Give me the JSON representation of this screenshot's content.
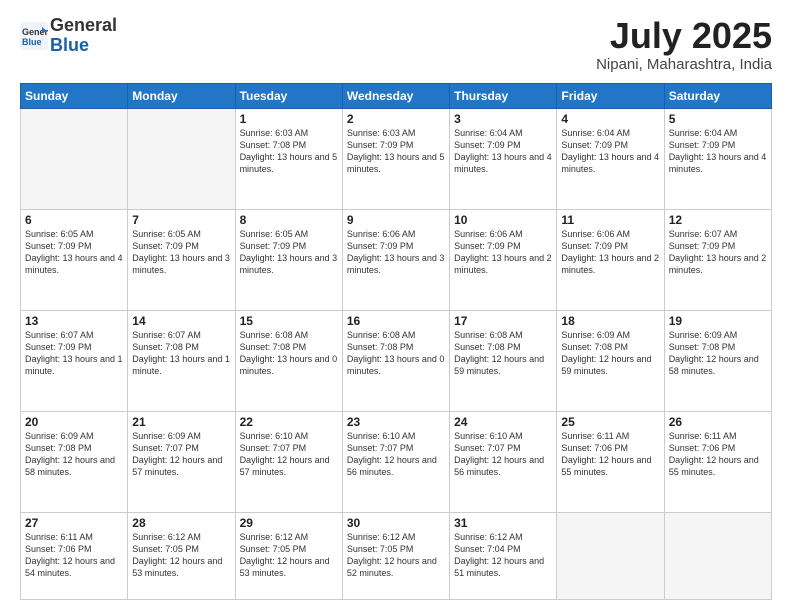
{
  "header": {
    "logo_general": "General",
    "logo_blue": "Blue",
    "month_title": "July 2025",
    "location": "Nipani, Maharashtra, India"
  },
  "days_of_week": [
    "Sunday",
    "Monday",
    "Tuesday",
    "Wednesday",
    "Thursday",
    "Friday",
    "Saturday"
  ],
  "weeks": [
    [
      {
        "day": "",
        "info": ""
      },
      {
        "day": "",
        "info": ""
      },
      {
        "day": "1",
        "info": "Sunrise: 6:03 AM\nSunset: 7:08 PM\nDaylight: 13 hours and 5 minutes."
      },
      {
        "day": "2",
        "info": "Sunrise: 6:03 AM\nSunset: 7:09 PM\nDaylight: 13 hours and 5 minutes."
      },
      {
        "day": "3",
        "info": "Sunrise: 6:04 AM\nSunset: 7:09 PM\nDaylight: 13 hours and 4 minutes."
      },
      {
        "day": "4",
        "info": "Sunrise: 6:04 AM\nSunset: 7:09 PM\nDaylight: 13 hours and 4 minutes."
      },
      {
        "day": "5",
        "info": "Sunrise: 6:04 AM\nSunset: 7:09 PM\nDaylight: 13 hours and 4 minutes."
      }
    ],
    [
      {
        "day": "6",
        "info": "Sunrise: 6:05 AM\nSunset: 7:09 PM\nDaylight: 13 hours and 4 minutes."
      },
      {
        "day": "7",
        "info": "Sunrise: 6:05 AM\nSunset: 7:09 PM\nDaylight: 13 hours and 3 minutes."
      },
      {
        "day": "8",
        "info": "Sunrise: 6:05 AM\nSunset: 7:09 PM\nDaylight: 13 hours and 3 minutes."
      },
      {
        "day": "9",
        "info": "Sunrise: 6:06 AM\nSunset: 7:09 PM\nDaylight: 13 hours and 3 minutes."
      },
      {
        "day": "10",
        "info": "Sunrise: 6:06 AM\nSunset: 7:09 PM\nDaylight: 13 hours and 2 minutes."
      },
      {
        "day": "11",
        "info": "Sunrise: 6:06 AM\nSunset: 7:09 PM\nDaylight: 13 hours and 2 minutes."
      },
      {
        "day": "12",
        "info": "Sunrise: 6:07 AM\nSunset: 7:09 PM\nDaylight: 13 hours and 2 minutes."
      }
    ],
    [
      {
        "day": "13",
        "info": "Sunrise: 6:07 AM\nSunset: 7:09 PM\nDaylight: 13 hours and 1 minute."
      },
      {
        "day": "14",
        "info": "Sunrise: 6:07 AM\nSunset: 7:08 PM\nDaylight: 13 hours and 1 minute."
      },
      {
        "day": "15",
        "info": "Sunrise: 6:08 AM\nSunset: 7:08 PM\nDaylight: 13 hours and 0 minutes."
      },
      {
        "day": "16",
        "info": "Sunrise: 6:08 AM\nSunset: 7:08 PM\nDaylight: 13 hours and 0 minutes."
      },
      {
        "day": "17",
        "info": "Sunrise: 6:08 AM\nSunset: 7:08 PM\nDaylight: 12 hours and 59 minutes."
      },
      {
        "day": "18",
        "info": "Sunrise: 6:09 AM\nSunset: 7:08 PM\nDaylight: 12 hours and 59 minutes."
      },
      {
        "day": "19",
        "info": "Sunrise: 6:09 AM\nSunset: 7:08 PM\nDaylight: 12 hours and 58 minutes."
      }
    ],
    [
      {
        "day": "20",
        "info": "Sunrise: 6:09 AM\nSunset: 7:08 PM\nDaylight: 12 hours and 58 minutes."
      },
      {
        "day": "21",
        "info": "Sunrise: 6:09 AM\nSunset: 7:07 PM\nDaylight: 12 hours and 57 minutes."
      },
      {
        "day": "22",
        "info": "Sunrise: 6:10 AM\nSunset: 7:07 PM\nDaylight: 12 hours and 57 minutes."
      },
      {
        "day": "23",
        "info": "Sunrise: 6:10 AM\nSunset: 7:07 PM\nDaylight: 12 hours and 56 minutes."
      },
      {
        "day": "24",
        "info": "Sunrise: 6:10 AM\nSunset: 7:07 PM\nDaylight: 12 hours and 56 minutes."
      },
      {
        "day": "25",
        "info": "Sunrise: 6:11 AM\nSunset: 7:06 PM\nDaylight: 12 hours and 55 minutes."
      },
      {
        "day": "26",
        "info": "Sunrise: 6:11 AM\nSunset: 7:06 PM\nDaylight: 12 hours and 55 minutes."
      }
    ],
    [
      {
        "day": "27",
        "info": "Sunrise: 6:11 AM\nSunset: 7:06 PM\nDaylight: 12 hours and 54 minutes."
      },
      {
        "day": "28",
        "info": "Sunrise: 6:12 AM\nSunset: 7:05 PM\nDaylight: 12 hours and 53 minutes."
      },
      {
        "day": "29",
        "info": "Sunrise: 6:12 AM\nSunset: 7:05 PM\nDaylight: 12 hours and 53 minutes."
      },
      {
        "day": "30",
        "info": "Sunrise: 6:12 AM\nSunset: 7:05 PM\nDaylight: 12 hours and 52 minutes."
      },
      {
        "day": "31",
        "info": "Sunrise: 6:12 AM\nSunset: 7:04 PM\nDaylight: 12 hours and 51 minutes."
      },
      {
        "day": "",
        "info": ""
      },
      {
        "day": "",
        "info": ""
      }
    ]
  ]
}
